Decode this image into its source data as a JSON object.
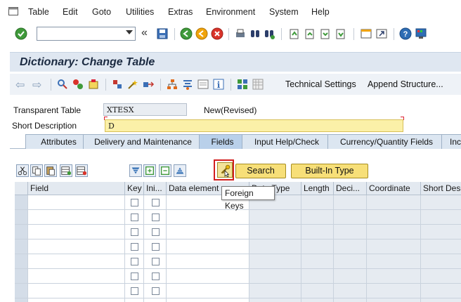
{
  "menu": {
    "items": [
      "Table",
      "Edit",
      "Goto",
      "Utilities",
      "Extras",
      "Environment",
      "System",
      "Help"
    ]
  },
  "system_toolbar": {
    "command_value": "",
    "icons": [
      "check-icon",
      "back-double-icon",
      "save-icon",
      "back-icon",
      "exit-icon",
      "cancel-icon",
      "print-icon",
      "find-icon",
      "find-next-icon",
      "first-page-icon",
      "prev-page-icon",
      "next-page-icon",
      "last-page-icon",
      "create-session-icon",
      "shortcut-icon",
      "help-icon",
      "customize-layout-icon"
    ]
  },
  "title": "Dictionary: Change Table",
  "app_toolbar": {
    "technical_settings": "Technical Settings",
    "append_structure": "Append Structure..."
  },
  "header": {
    "transparent_table_label": "Transparent Table",
    "transparent_table_value": "XTESX",
    "status": "New(Revised)",
    "short_description_label": "Short Description",
    "short_description_value": "D"
  },
  "tabs": [
    "Attributes",
    "Delivery and Maintenance",
    "Fields",
    "Input Help/Check",
    "Currency/Quantity Fields",
    "Inc"
  ],
  "active_tab": "Fields",
  "table_toolbar": {
    "search_label": "Search",
    "builtin_type_label": "Built-In Type",
    "tooltip": "Foreign Keys"
  },
  "grid": {
    "columns": [
      "Field",
      "Key",
      "Ini...",
      "Data element",
      "Data Type",
      "Length",
      "Deci...",
      "Coordinate",
      "Short Descript"
    ],
    "row_count": 8
  },
  "colors": {
    "title_bg": "#dfe7f1",
    "required_field_bg": "#fbf0a8",
    "yellow_button": "#f7df78",
    "highlight_box": "#d21f1f"
  }
}
